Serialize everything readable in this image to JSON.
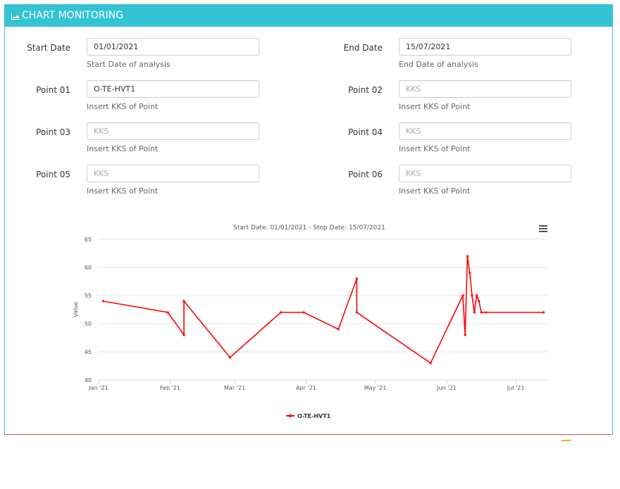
{
  "header": {
    "title": "CHART MONITORING",
    "icon": "area-chart-icon"
  },
  "form": {
    "start_date": {
      "label": "Start Date",
      "value": "01/01/2021",
      "help": "Start Date of analysis"
    },
    "end_date": {
      "label": "End Date",
      "value": "15/07/2021",
      "help": "End Date of analysis"
    },
    "points": [
      {
        "label": "Point 01",
        "value": "O-TE-HVT1",
        "placeholder": "KKS",
        "help": "Insert KKS of Point"
      },
      {
        "label": "Point 02",
        "value": "",
        "placeholder": "KKS",
        "help": "Insert KKS of Point"
      },
      {
        "label": "Point 03",
        "value": "",
        "placeholder": "KKS",
        "help": "Insert KKS of Point"
      },
      {
        "label": "Point 04",
        "value": "",
        "placeholder": "KKS",
        "help": "Insert KKS of Point"
      },
      {
        "label": "Point 05",
        "value": "",
        "placeholder": "KKS",
        "help": "Insert KKS of Point"
      },
      {
        "label": "Point 06",
        "value": "",
        "placeholder": "KKS",
        "help": "Insert KKS of Point"
      }
    ]
  },
  "colors": {
    "accent": "#33c3d3",
    "series": "#ff0000",
    "bottom_border": "#d9534f"
  },
  "chart_data": {
    "type": "line",
    "title": "Start Date: 01/01/2021 - Stop Date: 15/07/2021",
    "ylabel": "Value",
    "xlabel": "",
    "ylim": [
      40,
      65
    ],
    "yticks": [
      "40",
      "45",
      "50",
      "55",
      "60",
      "65"
    ],
    "xlim": [
      "2021-01-01",
      "2021-07-15"
    ],
    "xticks": [
      {
        "date": "2021-01-01",
        "label": "Jan '21"
      },
      {
        "date": "2021-02-01",
        "label": "Feb '21"
      },
      {
        "date": "2021-03-01",
        "label": "Mar '21"
      },
      {
        "date": "2021-04-01",
        "label": "Apr '21"
      },
      {
        "date": "2021-05-01",
        "label": "May '21"
      },
      {
        "date": "2021-06-01",
        "label": "Jun '21"
      },
      {
        "date": "2021-07-01",
        "label": "Jul '21"
      }
    ],
    "grid": true,
    "legend": "bottom-center",
    "series": [
      {
        "name": "O-TE-HVT1",
        "color": "#ff0000",
        "points": [
          {
            "x": "2021-01-03",
            "y": 54
          },
          {
            "x": "2021-01-31",
            "y": 52
          },
          {
            "x": "2021-02-07",
            "y": 48
          },
          {
            "x": "2021-02-07",
            "y": 54
          },
          {
            "x": "2021-02-27",
            "y": 44
          },
          {
            "x": "2021-03-21",
            "y": 52
          },
          {
            "x": "2021-03-31",
            "y": 52
          },
          {
            "x": "2021-04-15",
            "y": 49
          },
          {
            "x": "2021-04-23",
            "y": 58
          },
          {
            "x": "2021-04-23",
            "y": 52
          },
          {
            "x": "2021-05-25",
            "y": 43
          },
          {
            "x": "2021-06-08",
            "y": 55
          },
          {
            "x": "2021-06-09",
            "y": 48
          },
          {
            "x": "2021-06-10",
            "y": 62
          },
          {
            "x": "2021-06-11",
            "y": 59
          },
          {
            "x": "2021-06-12",
            "y": 55
          },
          {
            "x": "2021-06-13",
            "y": 52
          },
          {
            "x": "2021-06-14",
            "y": 55
          },
          {
            "x": "2021-06-15",
            "y": 54
          },
          {
            "x": "2021-06-16",
            "y": 52
          },
          {
            "x": "2021-06-18",
            "y": 52
          },
          {
            "x": "2021-07-13",
            "y": 52
          }
        ]
      }
    ]
  }
}
